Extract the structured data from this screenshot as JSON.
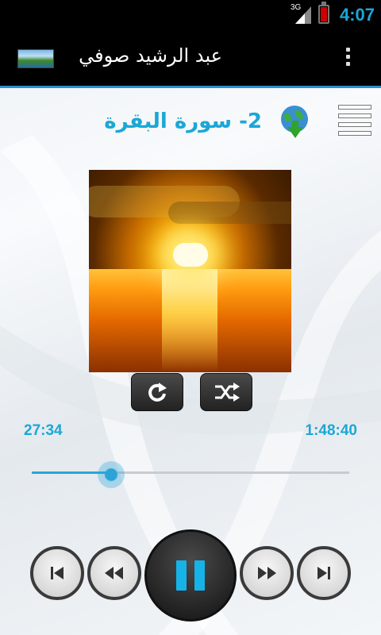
{
  "status_bar": {
    "time": "4:07",
    "network": "3G"
  },
  "app": {
    "title": "عبد الرشيد صوفي"
  },
  "player": {
    "track_title": "2- سورة البقرة",
    "elapsed": "27:34",
    "total": "1:48:40",
    "progress_fraction": 0.25
  },
  "icons": {
    "menu": "menu-icon",
    "download": "download-globe-icon",
    "repeat": "repeat-icon",
    "shuffle": "shuffle-icon",
    "previous": "skip-previous-icon",
    "rewind": "rewind-icon",
    "pause": "pause-icon",
    "fast_forward": "fast-forward-icon",
    "next": "skip-next-icon"
  },
  "colors": {
    "accent": "#1ba7d6",
    "actionbar_border": "#2b8fcf"
  }
}
